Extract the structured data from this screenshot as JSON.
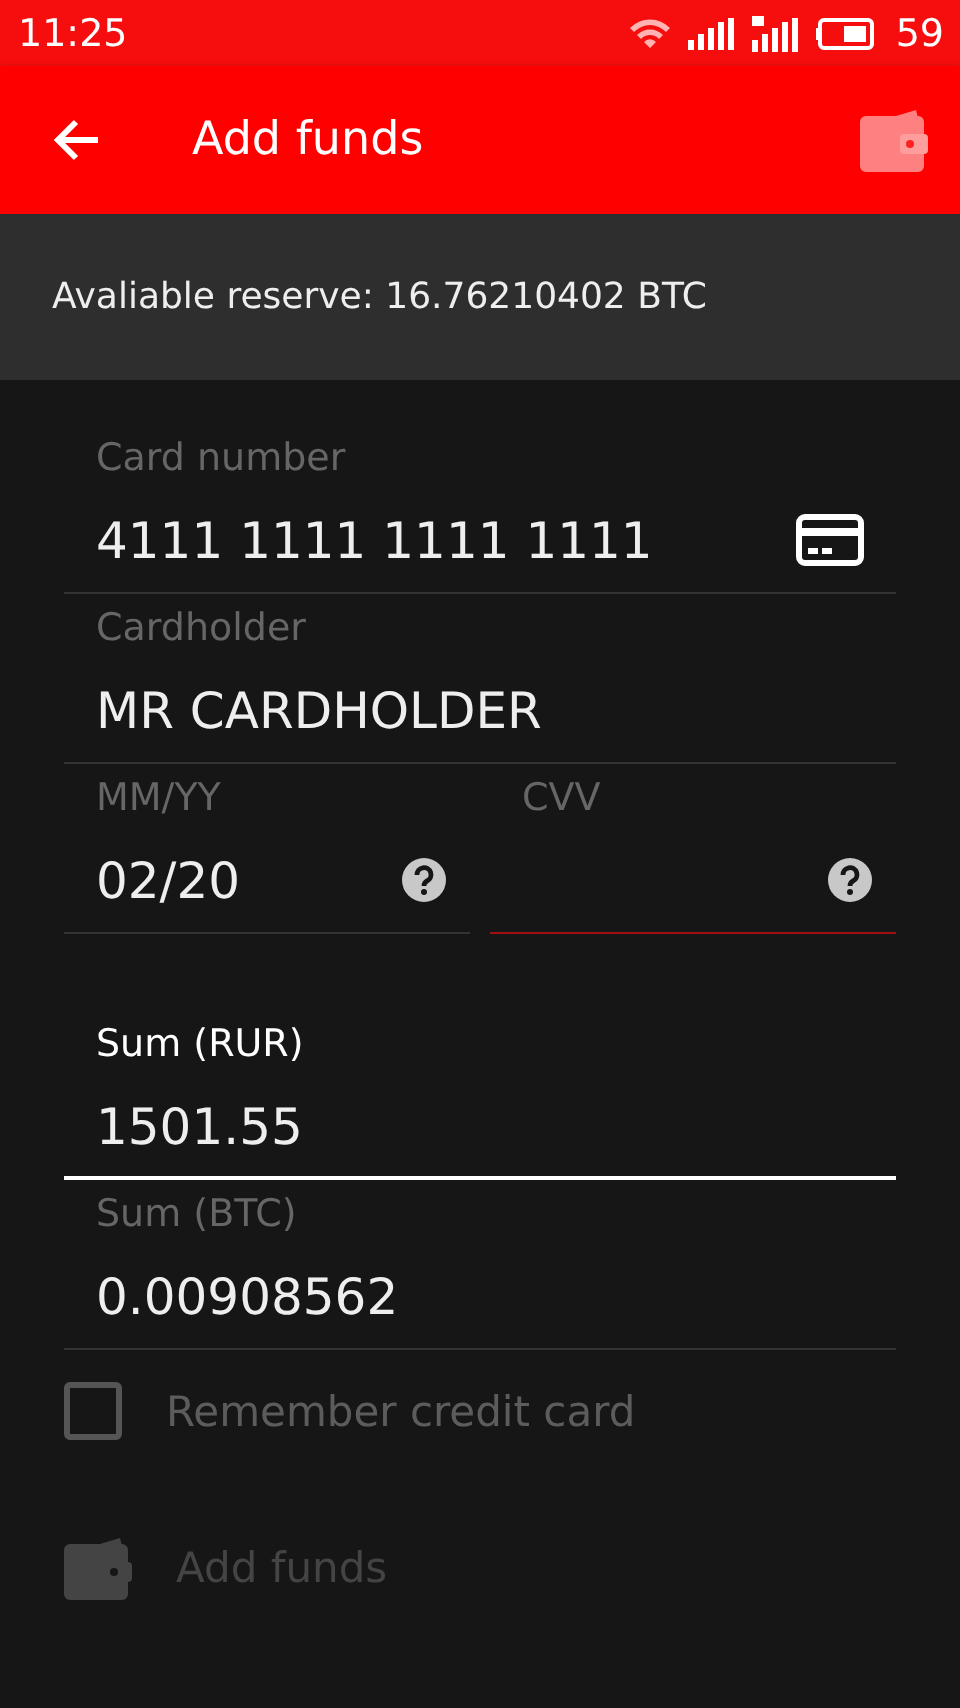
{
  "status_bar": {
    "time": "11:25",
    "battery": "59"
  },
  "app_bar": {
    "title": "Add funds"
  },
  "reserve": {
    "text": "Avaliable reserve: 16.76210402 BTC"
  },
  "card_rows": [
    {
      "fields": [
        {
          "label": "Card number",
          "value": "4111 1111 1111 1111",
          "kind": "card",
          "focused": false,
          "error": false
        }
      ]
    },
    {
      "fields": [
        {
          "label": "Cardholder",
          "value": "MR CARDHOLDER",
          "focused": false,
          "error": false
        }
      ]
    },
    {
      "fields": [
        {
          "label": "MM/YY",
          "value": "02/20",
          "kind": "help",
          "focused": false,
          "error": false
        },
        {
          "label": "CVV",
          "kind": "help",
          "focused": false,
          "error": true
        }
      ]
    }
  ],
  "sum_rows": [
    {
      "fields": [
        {
          "label": "Sum (RUR)",
          "value": "1501.55",
          "focused": true,
          "error": false
        }
      ]
    },
    {
      "fields": [
        {
          "label": "Sum (BTC)",
          "value": "0.00908562",
          "focused": false,
          "error": false
        }
      ]
    }
  ],
  "remember": {
    "label": "Remember credit card",
    "checked": false
  },
  "submit": {
    "label": "Add funds",
    "disabled": true
  }
}
